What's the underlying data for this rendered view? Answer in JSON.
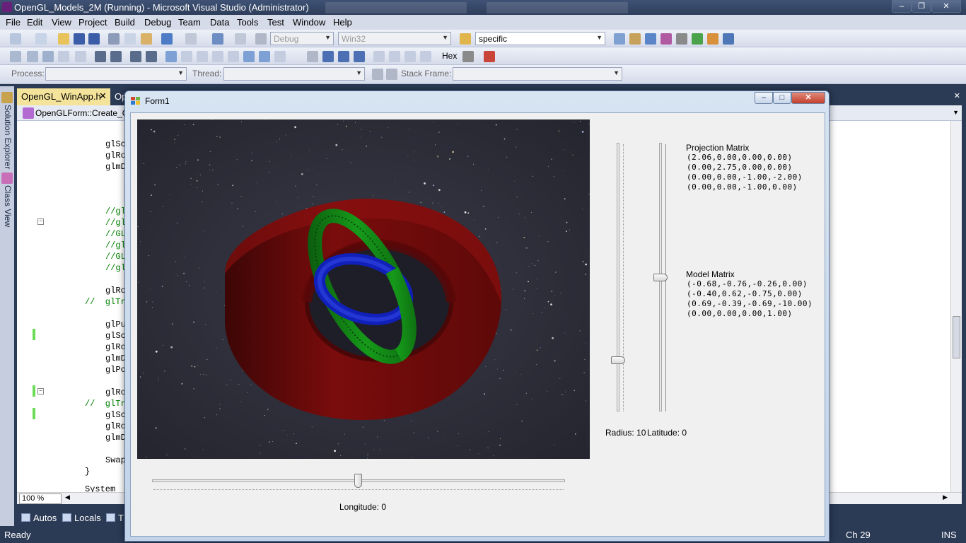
{
  "vs": {
    "title": "OpenGL_Models_2M (Running) - Microsoft Visual Studio (Administrator)",
    "menu": [
      "File",
      "Edit",
      "View",
      "Project",
      "Build",
      "Debug",
      "Team",
      "Data",
      "Tools",
      "Test",
      "Window",
      "Help"
    ],
    "toolbar": {
      "config": "Debug",
      "platform": "Win32",
      "find": "specific",
      "hex_label": "Hex",
      "process_label": "Process:",
      "thread_label": "Thread:",
      "stack_frame_label": "Stack Frame:"
    },
    "side_tabs": [
      "Solution Explorer",
      "Class View"
    ],
    "doc_tabs": [
      "OpenGL_WinApp.h",
      "Op"
    ],
    "nav_member": "OpenGLForm::Create_O",
    "code_lines": [
      {
        "text": "glSc",
        "comment": false
      },
      {
        "text": "glRo",
        "comment": false
      },
      {
        "text": "glmD",
        "comment": false
      },
      {
        "text": "//gl",
        "comment": true
      },
      {
        "text": "//gl",
        "comment": true
      },
      {
        "text": "//GL",
        "comment": true
      },
      {
        "text": "//gl",
        "comment": true
      },
      {
        "text": "//GL",
        "comment": true
      },
      {
        "text": "//gl",
        "comment": true
      },
      {
        "text": "glRo",
        "comment": false
      },
      {
        "text": "//  glTr",
        "comment": true
      },
      {
        "text": "glPu",
        "comment": false
      },
      {
        "text": "glSc",
        "comment": false
      },
      {
        "text": "glRo",
        "comment": false
      },
      {
        "text": "glmD",
        "comment": false
      },
      {
        "text": "glPo",
        "comment": false
      },
      {
        "text": "glRo",
        "comment": false
      },
      {
        "text": "//  glTr",
        "comment": true
      },
      {
        "text": "glSc",
        "comment": false
      },
      {
        "text": "glRo",
        "comment": false
      },
      {
        "text": "glmD",
        "comment": false
      },
      {
        "text": "Swap",
        "comment": false
      },
      {
        "text": "}",
        "comment": false
      },
      {
        "text": "System",
        "comment": false
      }
    ],
    "zoom": "100 %",
    "bottom_tabs": [
      "Autos",
      "Locals",
      "T"
    ],
    "status": {
      "state": "Ready",
      "column": "Ch 29",
      "mode": "INS"
    }
  },
  "form": {
    "title": "Form1",
    "projection_title": "Projection Matrix",
    "projection_rows": [
      "(2.06,0.00,0.00,0.00)",
      "(0.00,2.75,0.00,0.00)",
      "(0.00,0.00,-1.00,-2.00)",
      "(0.00,0.00,-1.00,0.00)"
    ],
    "model_title": "Model Matrix",
    "model_rows": [
      "(-0.68,-0.76,-0.26,0.00)",
      "(-0.40,0.62,-0.75,0.00)",
      "(0.69,-0.39,-0.69,-10.00)",
      "(0.00,0.00,0.00,1.00)"
    ],
    "radius_label": "Radius: 10",
    "latitude_label": "Latitude: 0",
    "longitude_label": "Longitude: 0",
    "radius_slider_value": 0.1,
    "latitude_slider_value": 0.5,
    "longitude_slider_value": 0.5,
    "colors": {
      "outer_ring": "#7a0c0c",
      "middle_ring": "#0f7a12",
      "inner_ring": "#1020b8"
    }
  }
}
